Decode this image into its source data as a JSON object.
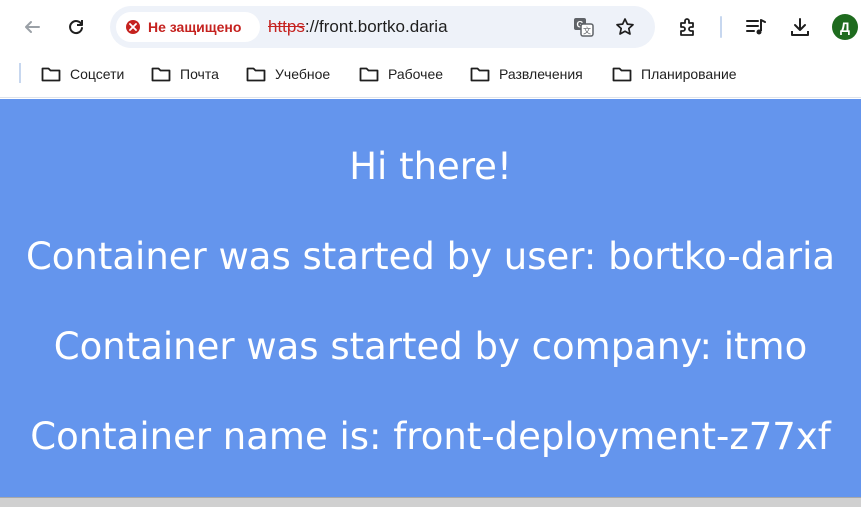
{
  "browser": {
    "security_label": "Не защищено",
    "url_scheme": "https",
    "url_rest": "://front.bortko.daria",
    "profile_initial": "Д",
    "accent_error": "#c5221f",
    "profile_color": "#1e6b1e",
    "icons": [
      "back-arrow-icon",
      "reload-icon",
      "error-icon",
      "translate-icon",
      "star-icon",
      "extensions-icon",
      "media-controls-icon",
      "download-icon"
    ]
  },
  "bookmarks": [
    {
      "label": "Соцсети"
    },
    {
      "label": "Почта"
    },
    {
      "label": "Учебное"
    },
    {
      "label": "Рабочее"
    },
    {
      "label": "Развлечения"
    },
    {
      "label": "Планирование"
    }
  ],
  "page": {
    "background": "#6495ed",
    "lines": [
      "Hi there!",
      "Container was started by user: bortko-daria",
      "Container was started by company: itmo",
      "Container name is: front-deployment-z77xf"
    ]
  }
}
